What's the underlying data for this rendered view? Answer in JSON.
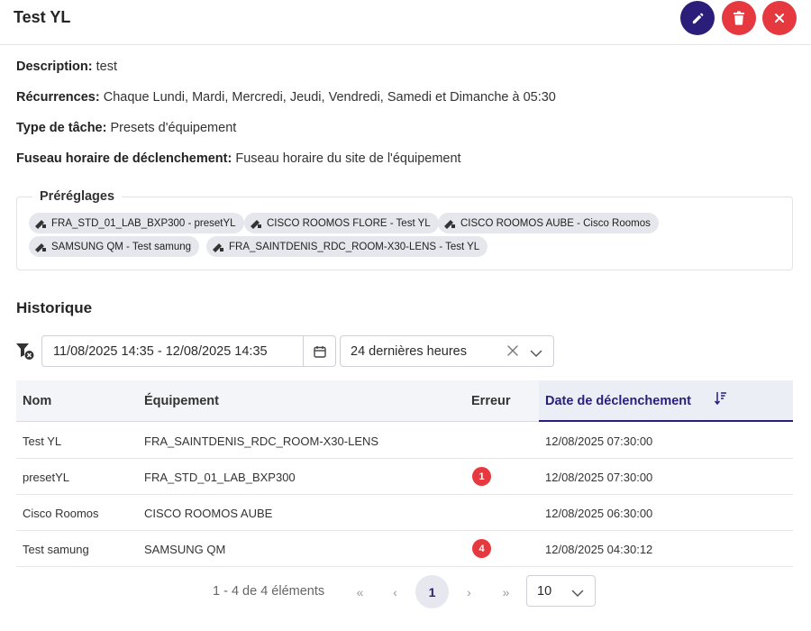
{
  "header": {
    "title": "Test YL"
  },
  "details": [
    {
      "label": "Description:",
      "value": "test"
    },
    {
      "label": "Récurrences:",
      "value": "Chaque Lundi, Mardi, Mercredi, Jeudi, Vendredi, Samedi et Dimanche à 05:30"
    },
    {
      "label": "Type de tâche:",
      "value": "Presets d'équipement"
    },
    {
      "label": "Fuseau horaire de déclenchement:",
      "value": "Fuseau horaire du site de l'équipement"
    }
  ],
  "presets": {
    "legend": "Préréglages",
    "chips": [
      "FRA_STD_01_LAB_BXP300 - presetYL",
      "CISCO ROOMOS FLORE - Test YL",
      "CISCO ROOMOS AUBE - Cisco Roomos",
      "SAMSUNG QM - Test samung",
      "FRA_SAINTDENIS_RDC_ROOM-X30-LENS - Test YL"
    ]
  },
  "history": {
    "title": "Historique",
    "date_range": "11/08/2025 14:35 - 12/08/2025 14:35",
    "period": "24 dernières heures",
    "columns": {
      "name": "Nom",
      "equipment": "Équipement",
      "error": "Erreur",
      "date": "Date de déclenchement"
    },
    "rows": [
      {
        "name": "Test YL",
        "equipment": "FRA_SAINTDENIS_RDC_ROOM-X30-LENS",
        "error": "",
        "date": "12/08/2025 07:30:00"
      },
      {
        "name": "presetYL",
        "equipment": "FRA_STD_01_LAB_BXP300",
        "error": "1",
        "date": "12/08/2025 07:30:00"
      },
      {
        "name": "Cisco Roomos",
        "equipment": "CISCO ROOMOS AUBE",
        "error": "",
        "date": "12/08/2025 06:30:00"
      },
      {
        "name": "Test samung",
        "equipment": "SAMSUNG QM",
        "error": "4",
        "date": "12/08/2025 04:30:12"
      }
    ]
  },
  "pagination": {
    "info": "1 - 4 de 4 éléments",
    "first": "«",
    "prev": "‹",
    "current": "1",
    "next": "›",
    "last": "»",
    "page_size": "10"
  },
  "colors": {
    "primary": "#2a1e7a",
    "danger": "#e5383f"
  }
}
